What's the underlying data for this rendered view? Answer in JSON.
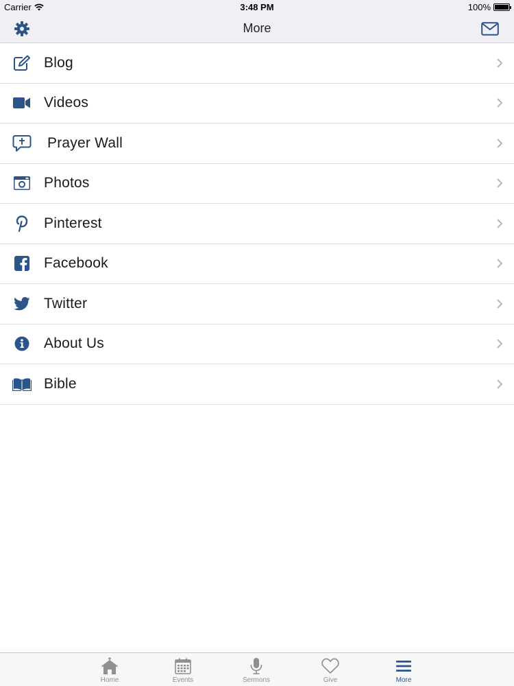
{
  "status_bar": {
    "carrier": "Carrier",
    "time": "3:48 PM",
    "battery": "100%"
  },
  "nav": {
    "title": "More",
    "left_icon": "gear-icon",
    "right_icon": "envelope-icon"
  },
  "menu": [
    {
      "label": "Blog",
      "icon": "edit-icon"
    },
    {
      "label": "Videos",
      "icon": "video-camera-icon"
    },
    {
      "label": "Prayer Wall",
      "icon": "prayer-speech-icon"
    },
    {
      "label": "Photos",
      "icon": "camera-icon"
    },
    {
      "label": "Pinterest",
      "icon": "pinterest-icon"
    },
    {
      "label": "Facebook",
      "icon": "facebook-icon"
    },
    {
      "label": "Twitter",
      "icon": "twitter-icon"
    },
    {
      "label": "About Us",
      "icon": "info-icon"
    },
    {
      "label": "Bible",
      "icon": "book-icon"
    }
  ],
  "tabs": [
    {
      "label": "Home",
      "icon": "church-icon"
    },
    {
      "label": "Events",
      "icon": "calendar-icon"
    },
    {
      "label": "Sermons",
      "icon": "microphone-icon"
    },
    {
      "label": "Give",
      "icon": "heart-icon"
    },
    {
      "label": "More",
      "icon": "menu-icon",
      "active": true
    }
  ],
  "colors": {
    "accent": "#2b5489",
    "tab_inactive": "#8e8e93",
    "bar_bg": "#efeff4"
  }
}
